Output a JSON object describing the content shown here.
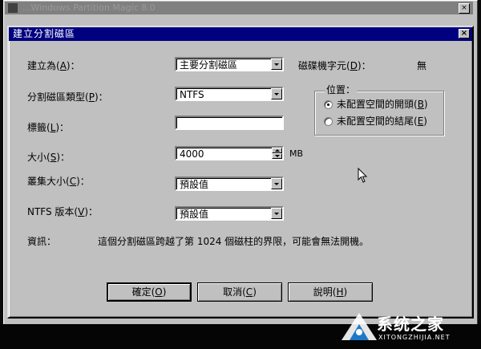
{
  "parent_window": {
    "title": "...Windows Partition Magic 8.0",
    "close_glyph": "×"
  },
  "dialog": {
    "title": "建立分割磁區",
    "close_glyph": "×"
  },
  "fields": {
    "create_as": {
      "label_pre": "建立為(",
      "key": "A",
      "label_post": ")：",
      "value": "主要分割磁區"
    },
    "partition_type": {
      "label_pre": "分割磁區類型(",
      "key": "P",
      "label_post": ")：",
      "value": "NTFS"
    },
    "label": {
      "label_pre": "標籤(",
      "key": "L",
      "label_post": ")：",
      "value": ""
    },
    "size": {
      "label_pre": "大小(",
      "key": "S",
      "label_post": ")：",
      "value": "4000",
      "unit": "MB"
    },
    "cluster_size": {
      "label_pre": "叢集大小(",
      "key": "C",
      "label_post": ")：",
      "value": "預設值"
    },
    "ntfs_version": {
      "label_pre": "NTFS 版本(",
      "key": "V",
      "label_post": ")：",
      "value": "預設值"
    },
    "drive_letter": {
      "label_pre": "磁碟機字元(",
      "key": "D",
      "label_post": ")：",
      "value": "無"
    }
  },
  "position": {
    "legend": "位置：",
    "options": [
      {
        "label_pre": "未配置空間的開頭(",
        "key": "B",
        "label_post": ")",
        "checked": true
      },
      {
        "label_pre": "未配置空間的結尾(",
        "key": "E",
        "label_post": ")",
        "checked": false
      }
    ]
  },
  "info": {
    "label": "資訊：",
    "message": "這個分割磁區跨越了第 1024 個磁柱的界限，可能會無法開機。"
  },
  "buttons": {
    "ok": {
      "label_pre": "確定(",
      "key": "O",
      "label_post": ")"
    },
    "cancel": {
      "label_pre": "取消(",
      "key": "C",
      "label_post": ")"
    },
    "help": {
      "label_pre": "說明(",
      "key": "H",
      "label_post": ")"
    }
  },
  "watermark": {
    "brand": "系统之家",
    "url": "XITONGZHIJIA.NET"
  },
  "colors": {
    "titlebar": "#000080",
    "face": "#c0c0c0"
  }
}
